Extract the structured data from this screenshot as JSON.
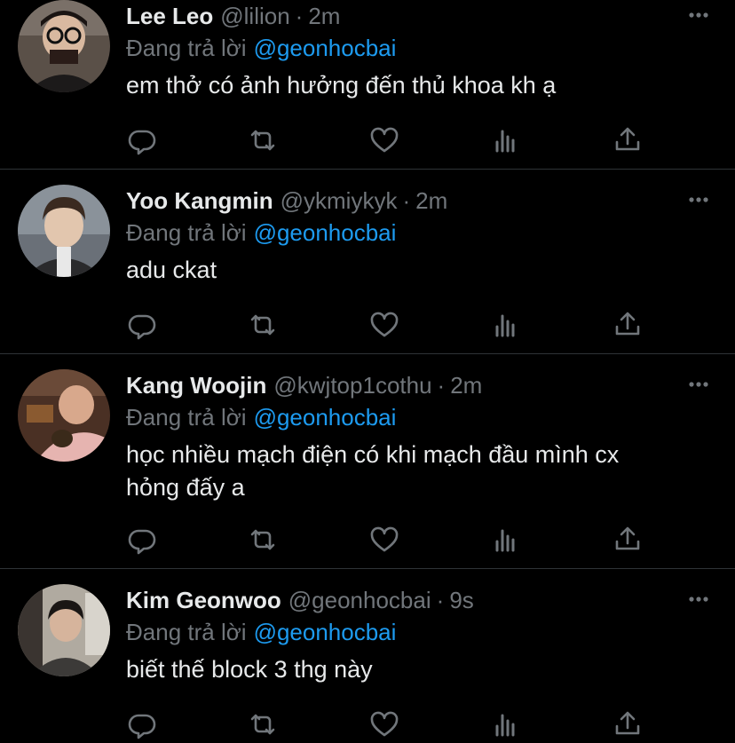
{
  "tweets": [
    {
      "name": "Lee Leo",
      "handle": "@lilion",
      "separator": "·",
      "time": "2m",
      "reply_prefix": "Đang trả lời",
      "reply_to": "@geonhocbai",
      "text": "em thở có ảnh hưởng đến thủ khoa kh ạ",
      "avatar_icon": "avatar-photo"
    },
    {
      "name": "Yoo Kangmin",
      "handle": "@ykmiykyk",
      "separator": "·",
      "time": "2m",
      "reply_prefix": "Đang trả lời",
      "reply_to": "@geonhocbai",
      "text": "adu ckat",
      "avatar_icon": "avatar-photo"
    },
    {
      "name": "Kang Woojin",
      "handle": "@kwjtop1cothu",
      "separator": "·",
      "time": "2m",
      "reply_prefix": "Đang trả lời",
      "reply_to": "@geonhocbai",
      "text": "học nhiều mạch điện có khi mạch đầu mình cx hỏng đấy a",
      "avatar_icon": "avatar-photo"
    },
    {
      "name": "Kim Geonwoo",
      "handle": "@geonhocbai",
      "separator": "·",
      "time": "9s",
      "reply_prefix": "Đang trả lời",
      "reply_to": "@geonhocbai",
      "text": "biết thế block 3 thg này",
      "avatar_icon": "avatar-photo"
    }
  ],
  "action_icons": [
    "reply-icon",
    "retweet-icon",
    "like-icon",
    "analytics-icon",
    "share-icon"
  ],
  "colors": {
    "background": "#000000",
    "text": "#e7e9ea",
    "secondary": "#71767b",
    "link": "#1d9bf0",
    "divider": "#2f3336"
  }
}
